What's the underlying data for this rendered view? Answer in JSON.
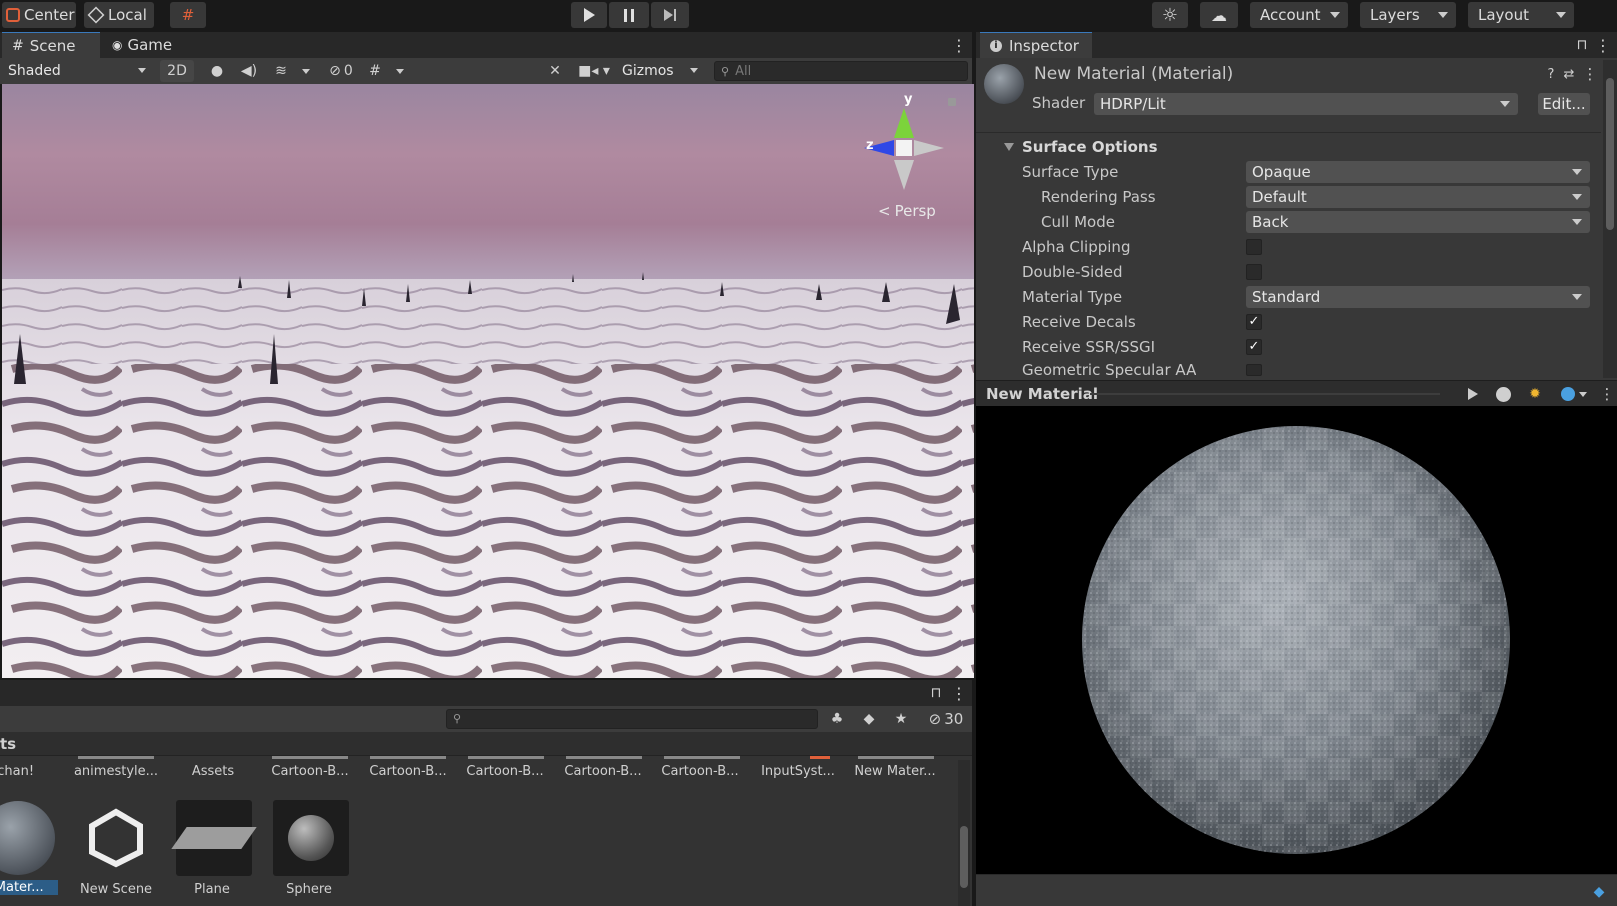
{
  "toolbar": {
    "pivot_center": "Center",
    "pivot_local": "Local",
    "account": "Account",
    "layers": "Layers",
    "layout": "Layout"
  },
  "scene": {
    "tabs": [
      "Scene",
      "Game"
    ],
    "shading": "Shaded",
    "mode_2d": "2D",
    "hidden_count": "0",
    "gizmos": "Gizmos",
    "search_placeholder": "All",
    "persp_label": "Persp",
    "axis_y": "y",
    "axis_z": "z"
  },
  "inspector": {
    "tab": "Inspector",
    "material_name": "New Material (Material)",
    "shader_label": "Shader",
    "shader_value": "HDRP/Lit",
    "edit_button": "Edit...",
    "section": "Surface Options",
    "rows": [
      {
        "label": "Surface Type",
        "value": "Opaque"
      },
      {
        "label": "Rendering Pass",
        "value": "Default"
      },
      {
        "label": "Cull Mode",
        "value": "Back"
      },
      {
        "label": "Alpha Clipping",
        "checked": false
      },
      {
        "label": "Double-Sided",
        "checked": false
      },
      {
        "label": "Material Type",
        "value": "Standard"
      },
      {
        "label": "Receive Decals",
        "checked": true
      },
      {
        "label": "Receive SSR/SSGI",
        "checked": true
      },
      {
        "label": "Geometric Specular AA",
        "checked": false
      }
    ],
    "check_mark": "✓",
    "preview_title": "New Material"
  },
  "project": {
    "hidden_count": "30",
    "breadcrumb": "ts",
    "folders": [
      "ty-chan!",
      "animestyle...",
      "Assets",
      "Cartoon-B...",
      "Cartoon-B...",
      "Cartoon-B...",
      "Cartoon-B...",
      "Cartoon-B...",
      "InputSyst...",
      "New Mater..."
    ],
    "assets": [
      "w Mater...",
      "New Scene",
      "Plane",
      "Sphere"
    ]
  },
  "colors": {
    "accent": "#3a79bb",
    "panel": "#383838",
    "header": "#282828"
  }
}
